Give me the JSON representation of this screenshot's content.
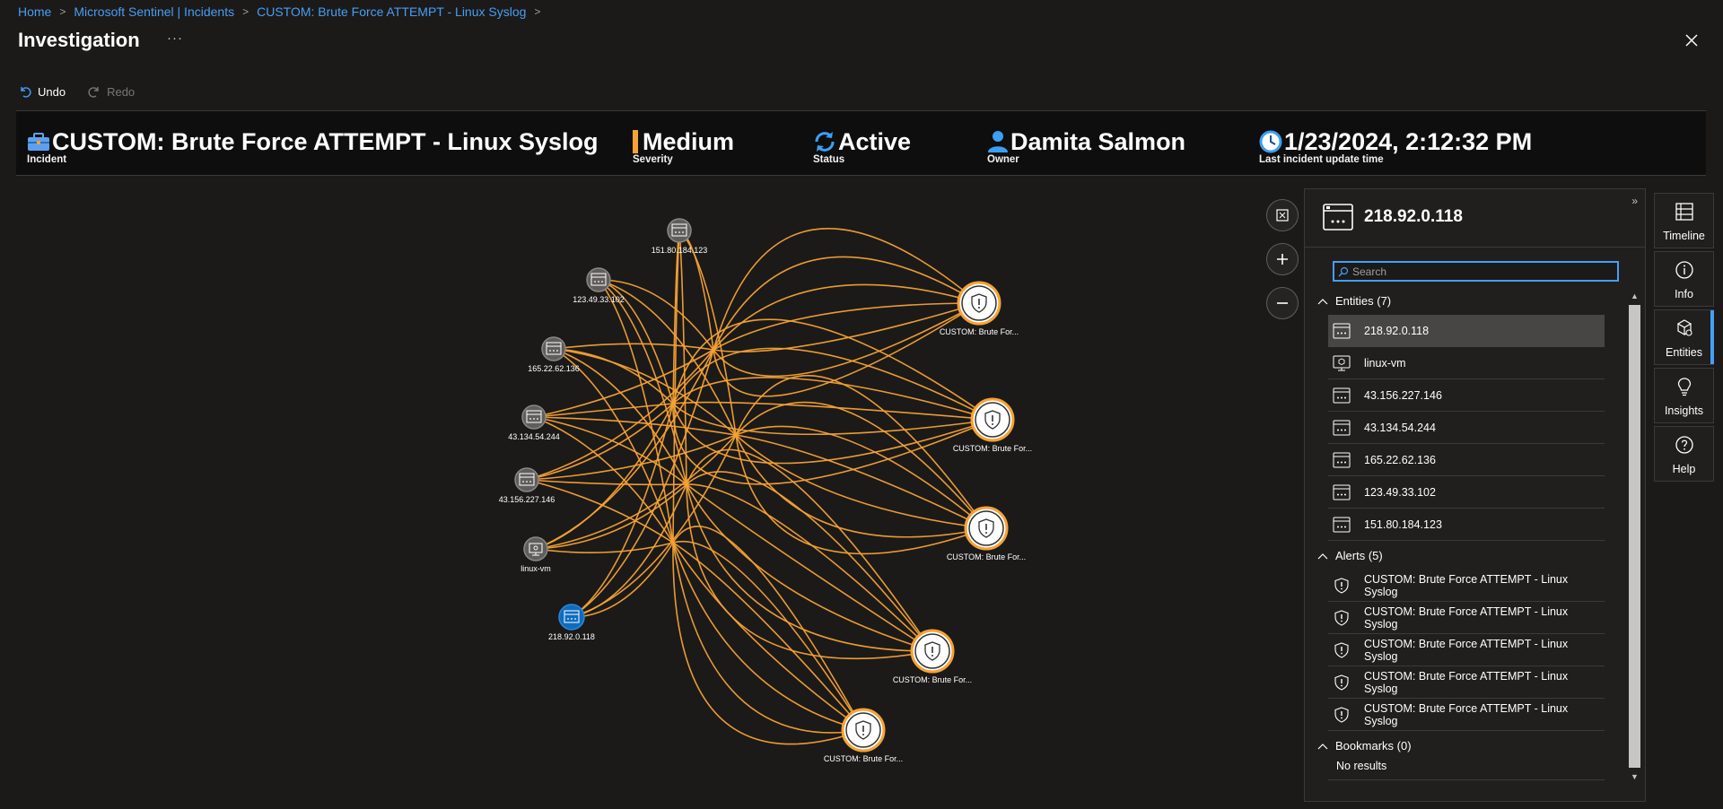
{
  "breadcrumb": [
    {
      "label": "Home"
    },
    {
      "label": "Microsoft Sentinel | Incidents"
    },
    {
      "label": "CUSTOM: Brute Force ATTEMPT - Linux Syslog"
    }
  ],
  "page": {
    "title": "Investigation",
    "more": "···"
  },
  "toolbar": {
    "undo": "Undo",
    "redo": "Redo"
  },
  "summary": {
    "incident": {
      "value": "CUSTOM: Brute Force ATTEMPT - Linux Syslog",
      "label": "Incident"
    },
    "severity": {
      "value": "Medium",
      "label": "Severity",
      "color": "#f7a234"
    },
    "status": {
      "value": "Active",
      "label": "Status"
    },
    "owner": {
      "value": "Damita Salmon",
      "label": "Owner"
    },
    "updated": {
      "value": "1/23/2024, 2:12:32 PM",
      "label": "Last incident update time"
    }
  },
  "graph": {
    "entities": [
      {
        "label": "151.80.184.123",
        "type": "ip"
      },
      {
        "label": "123.49.33.102",
        "type": "ip"
      },
      {
        "label": "165.22.62.136",
        "type": "ip"
      },
      {
        "label": "43.134.54.244",
        "type": "ip"
      },
      {
        "label": "43.156.227.146",
        "type": "ip"
      },
      {
        "label": "linux-vm",
        "type": "host"
      },
      {
        "label": "218.92.0.118",
        "type": "ip",
        "selected": true
      }
    ],
    "alerts": [
      {
        "label": "CUSTOM: Brute For..."
      },
      {
        "label": "CUSTOM: Brute For..."
      },
      {
        "label": "CUSTOM: Brute For..."
      },
      {
        "label": "CUSTOM: Brute For..."
      },
      {
        "label": "CUSTOM: Brute For..."
      }
    ],
    "edge_color": "#f7a234",
    "selected_color": "#0f6cbd"
  },
  "panel": {
    "title": "218.92.0.118",
    "search_placeholder": "Search",
    "entities_header": "Entities (7)",
    "entities": [
      {
        "label": "218.92.0.118",
        "icon": "ip-icon",
        "selected": true
      },
      {
        "label": "linux-vm",
        "icon": "host-icon"
      },
      {
        "label": "43.156.227.146",
        "icon": "ip-icon"
      },
      {
        "label": "43.134.54.244",
        "icon": "ip-icon"
      },
      {
        "label": "165.22.62.136",
        "icon": "ip-icon"
      },
      {
        "label": "123.49.33.102",
        "icon": "ip-icon"
      },
      {
        "label": "151.80.184.123",
        "icon": "ip-icon"
      }
    ],
    "alerts_header": "Alerts (5)",
    "alerts": [
      {
        "label": "CUSTOM: Brute Force ATTEMPT - Linux Syslog"
      },
      {
        "label": "CUSTOM: Brute Force ATTEMPT - Linux Syslog"
      },
      {
        "label": "CUSTOM: Brute Force ATTEMPT - Linux Syslog"
      },
      {
        "label": "CUSTOM: Brute Force ATTEMPT - Linux Syslog"
      },
      {
        "label": "CUSTOM: Brute Force ATTEMPT - Linux Syslog"
      }
    ],
    "bookmarks_header": "Bookmarks (0)",
    "bookmarks_empty": "No results"
  },
  "side_tabs": [
    {
      "label": "Timeline",
      "icon": "timeline-icon"
    },
    {
      "label": "Info",
      "icon": "info-icon"
    },
    {
      "label": "Entities",
      "icon": "entities-icon",
      "active": true
    },
    {
      "label": "Insights",
      "icon": "lightbulb-icon"
    },
    {
      "label": "Help",
      "icon": "help-icon"
    }
  ]
}
